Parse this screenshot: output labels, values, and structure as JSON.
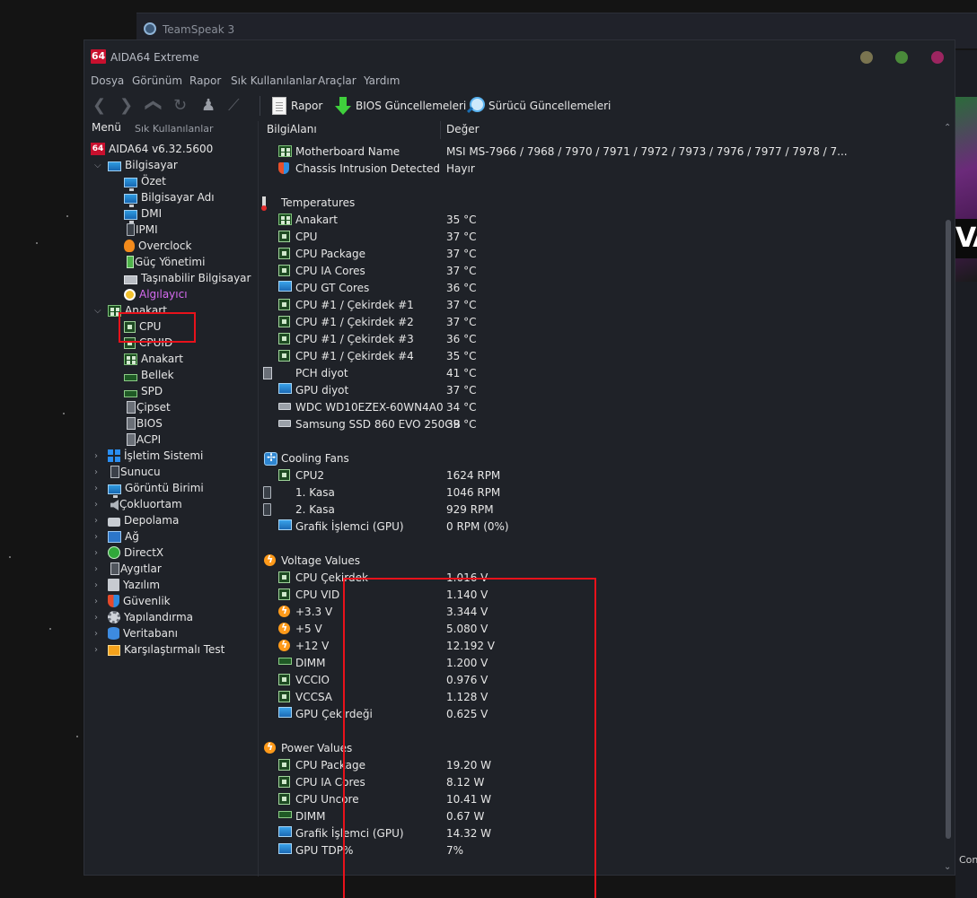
{
  "background": {
    "teamspeak_title": "TeamSpeak 3",
    "right_banner_text": "VA",
    "right_bottom_text": "Con"
  },
  "window": {
    "logo": "64",
    "title": "AIDA64 Extreme",
    "buttons": [
      {
        "name": "minimize",
        "color": "#7a7450"
      },
      {
        "name": "maximize",
        "color": "#4a8a3a"
      },
      {
        "name": "close",
        "color": "#9c2560"
      }
    ]
  },
  "menu": [
    "Dosya",
    "Görünüm",
    "Rapor",
    "Sık Kullanılanlar",
    "Araçlar",
    "Yardım"
  ],
  "toolbar": {
    "report": "Rapor",
    "bios_updates": "BIOS Güncellemeleri",
    "driver_updates": "Sürücü Güncellemeleri"
  },
  "left_tabs": {
    "menu": "Menü",
    "favorites": "Sık Kullanılanlar"
  },
  "tree": {
    "root": "AIDA64 v6.32.5600",
    "computer": {
      "label": "Bilgisayar",
      "children": [
        "Özet",
        "Bilgisayar Adı",
        "DMI",
        "IPMI",
        "Overclock",
        "Güç Yönetimi",
        "Taşınabilir Bilgisayar",
        "Algılayıcı"
      ]
    },
    "motherboard": {
      "label": "Anakart",
      "children": [
        "CPU",
        "CPUID",
        "Anakart",
        "Bellek",
        "SPD",
        "Çipset",
        "BIOS",
        "ACPI"
      ]
    },
    "others": [
      "İşletim Sistemi",
      "Sunucu",
      "Görüntü Birimi",
      "Çokluortam",
      "Depolama",
      "Ağ",
      "DirectX",
      "Aygıtlar",
      "Yazılım",
      "Güvenlik",
      "Yapılandırma",
      "Veritabanı",
      "Karşılaştırmalı Test"
    ]
  },
  "columns": {
    "field": "BilgiAlanı",
    "value": "Değer"
  },
  "sensor": {
    "top_rows": [
      {
        "name": "Motherboard Name",
        "value": "MSI MS-7966 / 7968 / 7970 / 7971 / 7972 / 7973 / 7976 / 7977 / 7978 / 7...",
        "icon": "board-icon"
      },
      {
        "name": "Chassis Intrusion Detected",
        "value": "Hayır",
        "icon": "shield-icon"
      }
    ],
    "groups": [
      {
        "title": "Temperatures",
        "icon": "thermometer-icon",
        "rows": [
          {
            "name": "Anakart",
            "value": "35 °C",
            "icon": "board-icon"
          },
          {
            "name": "CPU",
            "value": "37 °C",
            "icon": "chip-icon"
          },
          {
            "name": "CPU Package",
            "value": "37 °C",
            "icon": "chip-icon"
          },
          {
            "name": "CPU IA Cores",
            "value": "37 °C",
            "icon": "chip-icon"
          },
          {
            "name": "CPU GT Cores",
            "value": "36 °C",
            "icon": "gpu-icon"
          },
          {
            "name": "CPU #1 / Çekirdek #1",
            "value": "37 °C",
            "icon": "chip-icon"
          },
          {
            "name": "CPU #1 / Çekirdek #2",
            "value": "37 °C",
            "icon": "chip-icon"
          },
          {
            "name": "CPU #1 / Çekirdek #3",
            "value": "36 °C",
            "icon": "chip-icon"
          },
          {
            "name": "CPU #1 / Çekirdek #4",
            "value": "35 °C",
            "icon": "chip-icon"
          },
          {
            "name": "PCH diyot",
            "value": "41 °C",
            "icon": "bios-icon"
          },
          {
            "name": "GPU diyot",
            "value": "37 °C",
            "icon": "gpu-icon"
          },
          {
            "name": "WDC WD10EZEX-60WN4A0",
            "value": "34 °C",
            "icon": "disk-icon"
          },
          {
            "name": "Samsung SSD 860 EVO 250GB",
            "value": "39 °C",
            "icon": "disk-icon"
          }
        ]
      },
      {
        "title": "Cooling Fans",
        "icon": "fan-icon",
        "rows": [
          {
            "name": "CPU2",
            "value": "1624 RPM",
            "icon": "chip-icon"
          },
          {
            "name": "1. Kasa",
            "value": "1046 RPM",
            "icon": "case-icon"
          },
          {
            "name": "2. Kasa",
            "value": "929 RPM",
            "icon": "case-icon"
          },
          {
            "name": "Grafik İşlemci (GPU)",
            "value": "0 RPM  (0%)",
            "icon": "gpu-icon"
          }
        ]
      },
      {
        "title": "Voltage Values",
        "icon": "bolt-icon",
        "rows": [
          {
            "name": "CPU Çekirdek",
            "value": "1.016 V",
            "icon": "chip-icon"
          },
          {
            "name": "CPU VID",
            "value": "1.140 V",
            "icon": "chip-icon"
          },
          {
            "name": "+3.3 V",
            "value": "3.344 V",
            "icon": "bolt-icon"
          },
          {
            "name": "+5 V",
            "value": "5.080 V",
            "icon": "bolt-icon"
          },
          {
            "name": "+12 V",
            "value": "12.192 V",
            "icon": "bolt-icon"
          },
          {
            "name": "DIMM",
            "value": "1.200 V",
            "icon": "ram-icon"
          },
          {
            "name": "VCCIO",
            "value": "0.976 V",
            "icon": "chip-icon"
          },
          {
            "name": "VCCSA",
            "value": "1.128 V",
            "icon": "chip-icon"
          },
          {
            "name": "GPU Çekirdeği",
            "value": "0.625 V",
            "icon": "gpu-icon"
          }
        ]
      },
      {
        "title": "Power Values",
        "icon": "bolt-icon",
        "rows": [
          {
            "name": "CPU Package",
            "value": "19.20 W",
            "icon": "chip-icon"
          },
          {
            "name": "CPU IA Cores",
            "value": "8.12 W",
            "icon": "chip-icon"
          },
          {
            "name": "CPU Uncore",
            "value": "10.41 W",
            "icon": "chip-icon"
          },
          {
            "name": "DIMM",
            "value": "0.67 W",
            "icon": "ram-icon"
          },
          {
            "name": "Grafik İşlemci (GPU)",
            "value": "14.32 W",
            "icon": "gpu-icon"
          },
          {
            "name": "GPU TDP%",
            "value": "7%",
            "icon": "gpu-icon"
          }
        ]
      }
    ]
  },
  "highlight_color": "#e8121b"
}
